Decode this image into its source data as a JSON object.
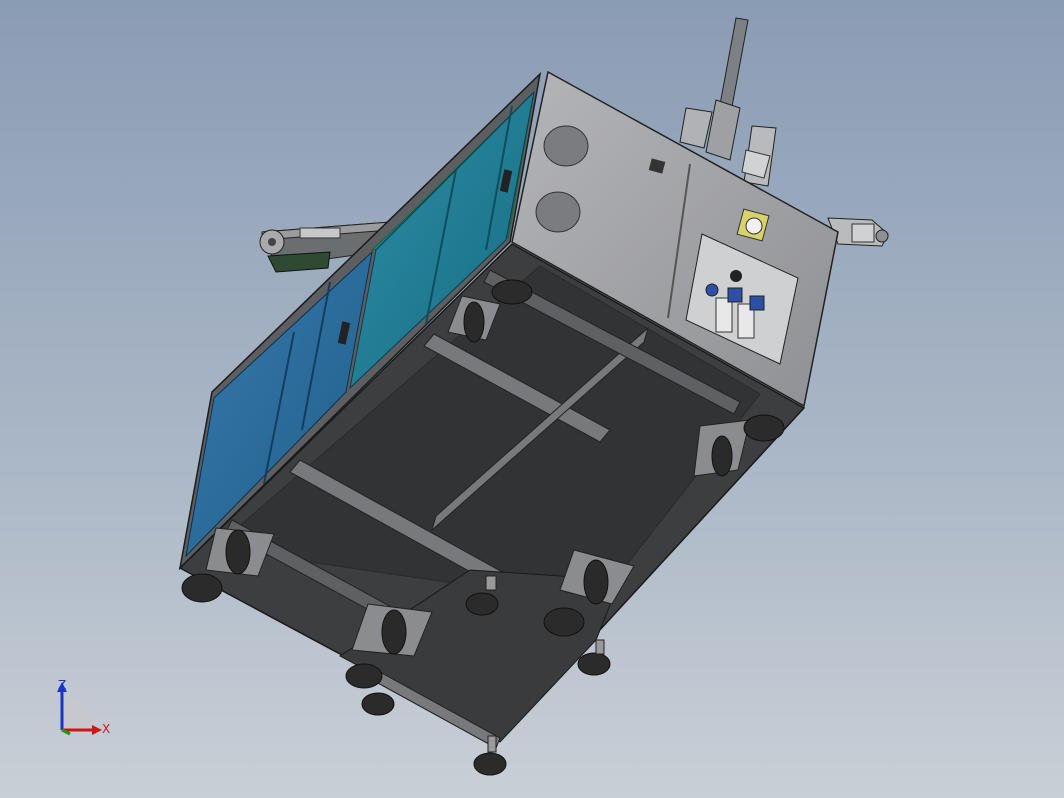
{
  "window": {
    "title": ""
  },
  "view": {
    "background_top": "#8a9cb4",
    "background_bottom": "#c9cfd6"
  },
  "model": {
    "name": "",
    "panel_colors": {
      "frame": "#8e9094",
      "base": "#3a3b3d",
      "side_panel_teal": "#1f7e96",
      "side_panel_blue": "#2a6a9c",
      "end_panel": "#a3a4a7"
    }
  },
  "triad": {
    "z_label": "Z",
    "x_label": "X",
    "z_color": "#1a33c8",
    "x_color": "#c81a1a",
    "y_color": "#1a9a1a"
  }
}
